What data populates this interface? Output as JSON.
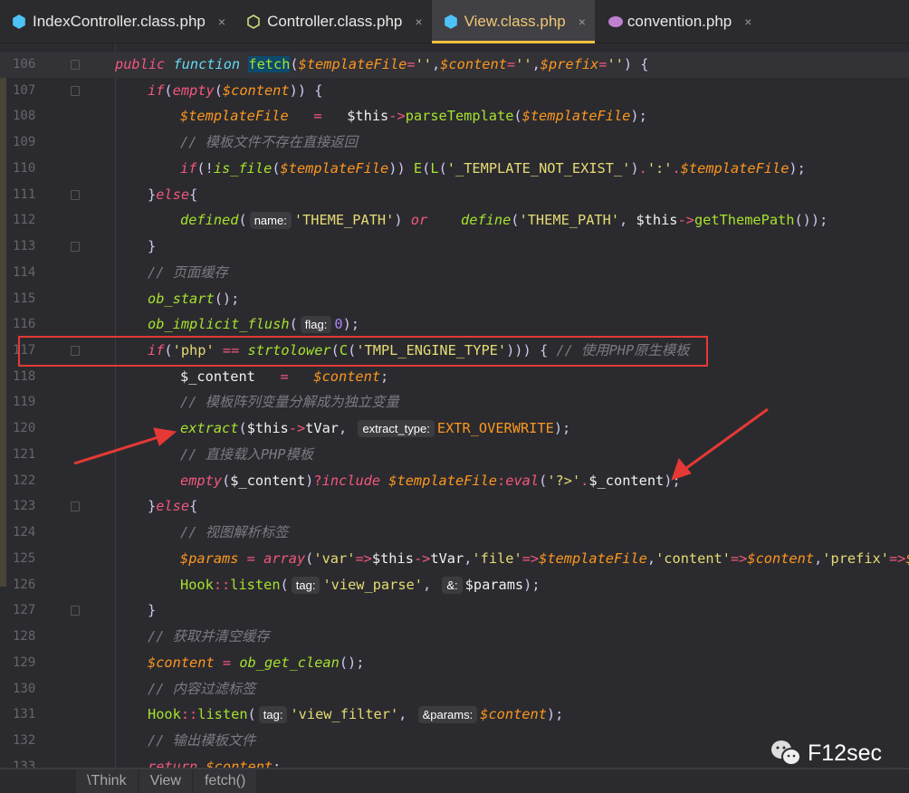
{
  "tabs": [
    {
      "label": "IndexController.class.php",
      "icon": "php-class-icon",
      "color": "#4fc3f7",
      "active": false
    },
    {
      "label": "Controller.class.php",
      "icon": "php-abstract-class-icon",
      "color": "#c5e07a",
      "active": false
    },
    {
      "label": "View.class.php",
      "icon": "php-class-icon",
      "color": "#4fc3f7",
      "active": true
    },
    {
      "label": "convention.php",
      "icon": "php-elephant-icon",
      "color": "#c080d0",
      "active": false
    }
  ],
  "close_glyph": "×",
  "lines": [
    {
      "n": "106",
      "i": 1,
      "cur": true,
      "t": [
        [
          "kw",
          "public "
        ],
        [
          "kwf",
          "function "
        ],
        [
          "fn sel",
          "fetch"
        ],
        [
          "p",
          "("
        ],
        [
          "var",
          "$templateFile"
        ],
        [
          "op",
          "="
        ],
        [
          "str",
          "''"
        ],
        [
          "p",
          ","
        ],
        [
          "var",
          "$content"
        ],
        [
          "op",
          "="
        ],
        [
          "str",
          "''"
        ],
        [
          "p",
          ","
        ],
        [
          "var",
          "$prefix"
        ],
        [
          "op",
          "="
        ],
        [
          "str",
          "''"
        ],
        [
          "p",
          ") {"
        ]
      ]
    },
    {
      "n": "107",
      "i": 2,
      "t": [
        [
          "kw",
          "if"
        ],
        [
          "p",
          "("
        ],
        [
          "kw",
          "empty"
        ],
        [
          "p",
          "("
        ],
        [
          "var",
          "$content"
        ],
        [
          "p",
          ")) {"
        ]
      ]
    },
    {
      "n": "108",
      "i": 3,
      "t": [
        [
          "var",
          "$templateFile"
        ],
        [
          "op",
          "   =   "
        ],
        [
          "pl",
          "$this"
        ],
        [
          "op",
          "->"
        ],
        [
          "fn",
          "parseTemplate"
        ],
        [
          "p",
          "("
        ],
        [
          "var",
          "$templateFile"
        ],
        [
          "p",
          ");"
        ]
      ]
    },
    {
      "n": "109",
      "i": 3,
      "t": [
        [
          "cm",
          "// 模板文件不存在直接返回"
        ]
      ]
    },
    {
      "n": "110",
      "i": 3,
      "t": [
        [
          "kw",
          "if"
        ],
        [
          "p",
          "(!"
        ],
        [
          "fni",
          "is_file"
        ],
        [
          "p",
          "("
        ],
        [
          "var",
          "$templateFile"
        ],
        [
          "p",
          ")) "
        ],
        [
          "fn",
          "E"
        ],
        [
          "p",
          "("
        ],
        [
          "fn",
          "L"
        ],
        [
          "p",
          "("
        ],
        [
          "str",
          "'_TEMPLATE_NOT_EXIST_'"
        ],
        [
          "p",
          ")"
        ],
        [
          "op",
          "."
        ],
        [
          "str",
          "':'"
        ],
        [
          "op",
          "."
        ],
        [
          "var",
          "$templateFile"
        ],
        [
          "p",
          ");"
        ]
      ]
    },
    {
      "n": "111",
      "i": 2,
      "t": [
        [
          "p",
          "}"
        ],
        [
          "kw",
          "else"
        ],
        [
          "p",
          "{"
        ]
      ]
    },
    {
      "n": "112",
      "i": 3,
      "t": [
        [
          "fni",
          "defined"
        ],
        [
          "p",
          "("
        ],
        [
          "hint",
          "name:"
        ],
        [
          "str",
          "'THEME_PATH'"
        ],
        [
          "p",
          ") "
        ],
        [
          "kw",
          "or"
        ],
        [
          "pl",
          "    "
        ],
        [
          "fni",
          "define"
        ],
        [
          "p",
          "("
        ],
        [
          "str",
          "'THEME_PATH'"
        ],
        [
          "p",
          ", "
        ],
        [
          "pl",
          "$this"
        ],
        [
          "op",
          "->"
        ],
        [
          "fn",
          "getThemePath"
        ],
        [
          "p",
          "());"
        ]
      ]
    },
    {
      "n": "113",
      "i": 2,
      "t": [
        [
          "p",
          "}"
        ]
      ]
    },
    {
      "n": "114",
      "i": 2,
      "t": [
        [
          "cm",
          "// 页面缓存"
        ]
      ]
    },
    {
      "n": "115",
      "i": 2,
      "t": [
        [
          "fni",
          "ob_start"
        ],
        [
          "p",
          "();"
        ]
      ]
    },
    {
      "n": "116",
      "i": 2,
      "t": [
        [
          "fni",
          "ob_implicit_flush"
        ],
        [
          "p",
          "("
        ],
        [
          "hint",
          "flag:"
        ],
        [
          "num",
          "0"
        ],
        [
          "p",
          ");"
        ]
      ]
    },
    {
      "n": "117",
      "i": 2,
      "t": [
        [
          "kw",
          "if"
        ],
        [
          "p",
          "("
        ],
        [
          "str",
          "'php'"
        ],
        [
          "op",
          " == "
        ],
        [
          "fni",
          "strtolower"
        ],
        [
          "p",
          "("
        ],
        [
          "fn",
          "C"
        ],
        [
          "p",
          "("
        ],
        [
          "str",
          "'TMPL_ENGINE_TYPE'"
        ],
        [
          "p",
          ")))"
        ],
        [
          "p",
          " { "
        ],
        [
          "cm",
          "// 使用PHP原生模板"
        ]
      ]
    },
    {
      "n": "118",
      "i": 3,
      "t": [
        [
          "pl",
          "$_content"
        ],
        [
          "op",
          "   =   "
        ],
        [
          "var",
          "$content"
        ],
        [
          "p",
          ";"
        ]
      ]
    },
    {
      "n": "119",
      "i": 3,
      "t": [
        [
          "cm",
          "// 模板阵列变量分解成为独立变量"
        ]
      ]
    },
    {
      "n": "120",
      "i": 3,
      "t": [
        [
          "fni",
          "extract"
        ],
        [
          "p",
          "("
        ],
        [
          "pl",
          "$this"
        ],
        [
          "op",
          "->"
        ],
        [
          "pl",
          "tVar"
        ],
        [
          "p",
          ", "
        ],
        [
          "hint",
          "extract_type:"
        ],
        [
          "cst",
          "EXTR_OVERWRITE"
        ],
        [
          "p",
          ");"
        ]
      ]
    },
    {
      "n": "121",
      "i": 3,
      "t": [
        [
          "cm",
          "// 直接载入PHP模板"
        ]
      ]
    },
    {
      "n": "122",
      "i": 3,
      "t": [
        [
          "kw",
          "empty"
        ],
        [
          "p",
          "("
        ],
        [
          "pl",
          "$_content"
        ],
        [
          "p",
          ")"
        ],
        [
          "op",
          "?"
        ],
        [
          "kw",
          "include "
        ],
        [
          "var",
          "$templateFile"
        ],
        [
          "op",
          ":"
        ],
        [
          "kw",
          "eval"
        ],
        [
          "p",
          "("
        ],
        [
          "str",
          "'?>'"
        ],
        [
          "op",
          "."
        ],
        [
          "pl",
          "$_content"
        ],
        [
          "p",
          ");"
        ]
      ]
    },
    {
      "n": "123",
      "i": 2,
      "t": [
        [
          "p",
          "}"
        ],
        [
          "kw",
          "else"
        ],
        [
          "p",
          "{"
        ]
      ]
    },
    {
      "n": "124",
      "i": 3,
      "t": [
        [
          "cm",
          "// 视图解析标签"
        ]
      ]
    },
    {
      "n": "125",
      "i": 3,
      "t": [
        [
          "var",
          "$params"
        ],
        [
          "op",
          " = "
        ],
        [
          "kw",
          "array"
        ],
        [
          "p",
          "("
        ],
        [
          "str",
          "'var'"
        ],
        [
          "op",
          "=>"
        ],
        [
          "pl",
          "$this"
        ],
        [
          "op",
          "->"
        ],
        [
          "pl",
          "tVar"
        ],
        [
          "p",
          ","
        ],
        [
          "str",
          "'file'"
        ],
        [
          "op",
          "=>"
        ],
        [
          "var",
          "$templateFile"
        ],
        [
          "p",
          ","
        ],
        [
          "str",
          "'content'"
        ],
        [
          "op",
          "=>"
        ],
        [
          "var",
          "$content"
        ],
        [
          "p",
          ","
        ],
        [
          "str",
          "'prefix'"
        ],
        [
          "op",
          "=>"
        ],
        [
          "var",
          "$pr"
        ]
      ]
    },
    {
      "n": "126",
      "i": 3,
      "t": [
        [
          "fn",
          "Hook"
        ],
        [
          "op",
          "::"
        ],
        [
          "fn",
          "listen"
        ],
        [
          "p",
          "("
        ],
        [
          "hint",
          "tag:"
        ],
        [
          "str",
          "'view_parse'"
        ],
        [
          "p",
          ", "
        ],
        [
          "hint",
          "&:"
        ],
        [
          "pl",
          "$params"
        ],
        [
          "p",
          ");"
        ]
      ]
    },
    {
      "n": "127",
      "i": 2,
      "t": [
        [
          "p",
          "}"
        ]
      ]
    },
    {
      "n": "128",
      "i": 2,
      "t": [
        [
          "cm",
          "// 获取并清空缓存"
        ]
      ]
    },
    {
      "n": "129",
      "i": 2,
      "t": [
        [
          "var",
          "$content"
        ],
        [
          "op",
          " = "
        ],
        [
          "fni",
          "ob_get_clean"
        ],
        [
          "p",
          "();"
        ]
      ]
    },
    {
      "n": "130",
      "i": 2,
      "t": [
        [
          "cm",
          "// 内容过滤标签"
        ]
      ]
    },
    {
      "n": "131",
      "i": 2,
      "t": [
        [
          "fn",
          "Hook"
        ],
        [
          "op",
          "::"
        ],
        [
          "fn",
          "listen"
        ],
        [
          "p",
          "("
        ],
        [
          "hint",
          "tag:"
        ],
        [
          "str",
          "'view_filter'"
        ],
        [
          "p",
          ", "
        ],
        [
          "hint",
          "&params:"
        ],
        [
          "var",
          "$content"
        ],
        [
          "p",
          ");"
        ]
      ]
    },
    {
      "n": "132",
      "i": 2,
      "t": [
        [
          "cm",
          "// 输出模板文件"
        ]
      ]
    },
    {
      "n": "133",
      "i": 2,
      "t": [
        [
          "kw",
          "return "
        ],
        [
          "var",
          "$content"
        ],
        [
          "p",
          ";"
        ]
      ]
    }
  ],
  "breadcrumb": [
    "\\Think",
    "View",
    "fetch()"
  ],
  "watermark": {
    "text": "F12sec",
    "icon": "wechat-icon"
  },
  "annotations": {
    "highlight_color": "#e53935"
  }
}
